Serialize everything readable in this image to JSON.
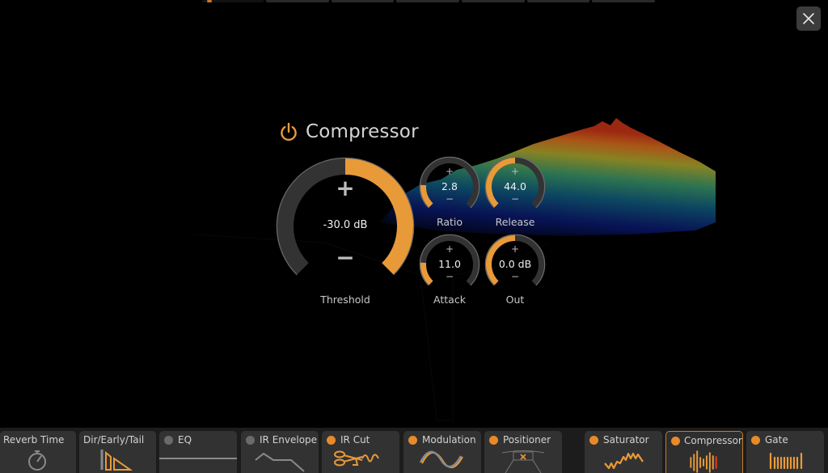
{
  "window": {
    "close_icon": "close-icon"
  },
  "colors": {
    "accent": "#E99A38",
    "track": "#333333",
    "led_off": "#6a6a6a",
    "led_on": "#E8892A",
    "tab_bg": "#323232",
    "tabbar_bg": "#1c1c1c"
  },
  "panel": {
    "title": "Compressor",
    "power_icon": "power-icon",
    "power_on": true
  },
  "knobs": {
    "threshold": {
      "label": "Threshold",
      "value": "-30.0 dB",
      "fill_from": 0.5,
      "fill_to": 1.0,
      "plus": "+",
      "minus": "−"
    },
    "ratio": {
      "label": "Ratio",
      "value": "2.8",
      "fill_from": 0.0,
      "fill_to": 0.18,
      "plus": "+",
      "minus": "−"
    },
    "release": {
      "label": "Release",
      "value": "44.0",
      "fill_from": 0.0,
      "fill_to": 0.5,
      "plus": "+",
      "minus": "−"
    },
    "attack": {
      "label": "Attack",
      "value": "11.0",
      "fill_from": 0.0,
      "fill_to": 0.18,
      "plus": "+",
      "minus": "−"
    },
    "out": {
      "label": "Out",
      "value": "0.0 dB",
      "fill_from": 0.0,
      "fill_to": 0.5,
      "plus": "+",
      "minus": "−"
    }
  },
  "tabs": [
    {
      "label": "Reverb Time",
      "led": null,
      "icon": "stopwatch-icon",
      "selected": false
    },
    {
      "label": "Dir/Early/Tail",
      "led": null,
      "icon": "dir-early-tail-icon",
      "selected": false
    },
    {
      "label": "EQ",
      "led": "off",
      "icon": "eq-flat-line-icon",
      "selected": false
    },
    {
      "label": "IR Envelope",
      "led": "off",
      "icon": "envelope-line-icon",
      "selected": false
    },
    {
      "label": "IR Cut",
      "led": "on",
      "icon": "scissors-icon",
      "selected": false
    },
    {
      "label": "Modulation",
      "led": "on",
      "icon": "sine-wave-icon",
      "selected": false
    },
    {
      "label": "Positioner",
      "led": "on",
      "icon": "positioner-icon",
      "selected": false
    },
    {
      "label": "Saturator",
      "led": "on",
      "icon": "zigzag-icon",
      "selected": false
    },
    {
      "label": "Compressor",
      "led": "on",
      "icon": "waveform-bars-icon",
      "selected": true
    },
    {
      "label": "Gate",
      "led": "on",
      "icon": "gate-bars-icon",
      "selected": false
    }
  ]
}
